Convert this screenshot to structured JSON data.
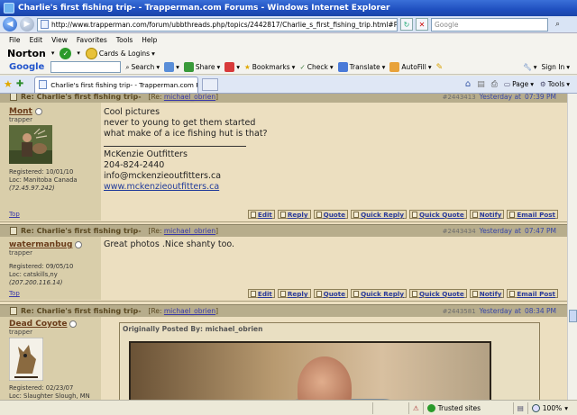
{
  "window": {
    "title": "Charlie's first fishing trip- - Trapperman.com Forums - Windows Internet Explorer"
  },
  "address_bar": {
    "url": "http://www.trapperman.com/forum/ubbthreads.php/topics/2442817/Charlie_s_first_fishing_trip.html#Post2442817",
    "search_placeholder": "Google"
  },
  "menu": [
    "File",
    "Edit",
    "View",
    "Favorites",
    "Tools",
    "Help"
  ],
  "norton": {
    "logo": "Norton",
    "cards_label": "Cards & Logins"
  },
  "google_toolbar": {
    "logo": "Google",
    "search_label": "Search",
    "share_label": "Share",
    "bookmarks_label": "Bookmarks",
    "check_label": "Check",
    "translate_label": "Translate",
    "autofill_label": "AutoFill",
    "signin_label": "Sign In"
  },
  "tab": {
    "label": "Charlie's first fishing trip- - Trapperman.com Forums"
  },
  "command_bar": {
    "page_label": "Page",
    "tools_label": "Tools"
  },
  "posts": [
    {
      "subject": "Re: Charlie's first fishing trip-",
      "re_prefix": "[Re:",
      "re_user": "michael_obrien",
      "re_suffix": "]",
      "post_number": "#2443413",
      "date": "Yesterday at",
      "time": "07:39 PM",
      "username": "Mont",
      "rank": "trapper",
      "registered": "Registered: 10/01/10",
      "location": "Loc: Manitoba Canada",
      "ip": "(72.45.97.242)",
      "body": [
        "Cool pictures",
        "never to young to get them started",
        "what make of a ice fishing hut is that?"
      ],
      "signature": [
        "McKenzie Outfitters",
        "204-824-2440",
        "info@mckenzieoutfitters.ca"
      ],
      "signature_link": "www.mckenzieoutfitters.ca",
      "top_label": "Top"
    },
    {
      "subject": "Re: Charlie's first fishing trip-",
      "re_prefix": "[Re:",
      "re_user": "michael_obrien",
      "re_suffix": "]",
      "post_number": "#2443434",
      "date": "Yesterday at",
      "time": "07:47 PM",
      "username": "watermanbug",
      "rank": "trapper",
      "registered": "Registered: 09/05/10",
      "location": "Loc: catskills,ny",
      "ip": "(207.200.116.14)",
      "body": [
        "Great photos .Nice shanty too."
      ],
      "top_label": "Top"
    },
    {
      "subject": "Re: Charlie's first fishing trip-",
      "re_prefix": "[Re:",
      "re_user": "michael_obrien",
      "re_suffix": "]",
      "post_number": "#2443581",
      "date": "Yesterday at",
      "time": "08:34 PM",
      "username": "Dead Coyote",
      "rank": "trapper",
      "registered": "Registered: 02/23/07",
      "location": "Loc: Slaughter Slough, MN",
      "quote_title": "Originally Posted By: michael_obrien"
    }
  ],
  "actions": [
    "Edit",
    "Reply",
    "Quote",
    "Quick Reply",
    "Quick Quote",
    "Notify",
    "Email Post"
  ],
  "status_bar": {
    "zone": "Trusted sites",
    "zoom": "100%"
  },
  "colors": {
    "title_bar": "#1f4fbf",
    "forum_bg": "#ecdfc0",
    "post_header_bg": "#b7ad8c",
    "link_blue": "#223c9a"
  }
}
